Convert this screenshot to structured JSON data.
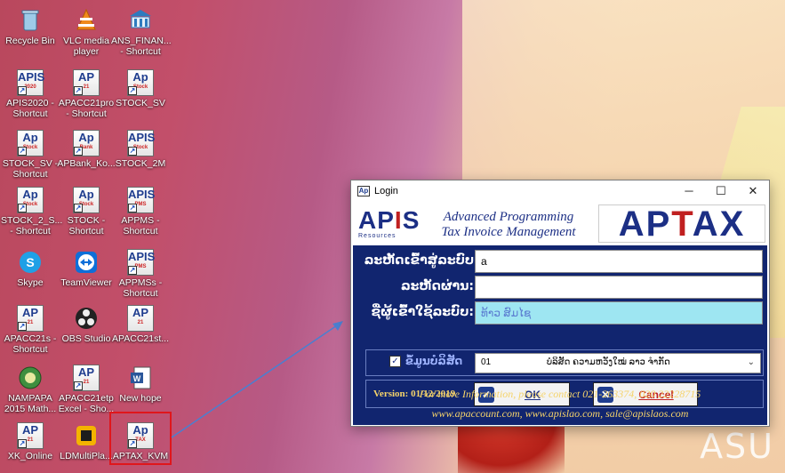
{
  "desktop": {
    "brand_text": "ASU",
    "icons": [
      {
        "label": "Recycle Bin",
        "icon": "recycle-bin-icon"
      },
      {
        "label": "VLC media player",
        "icon": "vlc-icon"
      },
      {
        "label": "ANS_FINAN... - Shortcut",
        "icon": "bank-icon"
      },
      {
        "label": "APIS2020 - Shortcut",
        "icon": "apis-icon"
      },
      {
        "label": "APACC21pro - Shortcut",
        "icon": "apacc-icon"
      },
      {
        "label": "STOCK_SV",
        "icon": "ap-icon"
      },
      {
        "label": "STOCK_SV - Shortcut",
        "icon": "ap-icon"
      },
      {
        "label": "APBank_Ko...",
        "icon": "ap-icon"
      },
      {
        "label": "STOCK_2M",
        "icon": "apis-icon"
      },
      {
        "label": "STOCK_2_S... - Shortcut",
        "icon": "ap-icon"
      },
      {
        "label": "STOCK - Shortcut",
        "icon": "ap-icon"
      },
      {
        "label": "APPMS - Shortcut",
        "icon": "apis-icon"
      },
      {
        "label": "Skype",
        "icon": "skype-icon"
      },
      {
        "label": "TeamViewer",
        "icon": "teamviewer-icon"
      },
      {
        "label": "APPMSs - Shortcut",
        "icon": "apis-icon"
      },
      {
        "label": "APACC21s - Shortcut",
        "icon": "apacc-icon"
      },
      {
        "label": "OBS Studio",
        "icon": "obs-icon"
      },
      {
        "label": "APACC21st...",
        "icon": "apacc-icon"
      },
      {
        "label": "NAMPAPA 2015 Math...",
        "icon": "nampapa-icon"
      },
      {
        "label": "APACC21etp Excel - Sho...",
        "icon": "apacc-icon"
      },
      {
        "label": "New hope",
        "icon": "word-doc-icon"
      },
      {
        "label": "XK_Online",
        "icon": "apacc-icon"
      },
      {
        "label": "LDMultiPla...",
        "icon": "ldplayer-icon"
      },
      {
        "label": "APTAX_KVM",
        "icon": "ap-icon"
      }
    ]
  },
  "window": {
    "title": "Login",
    "minimize": "─",
    "maximize": "☐",
    "close": "✕",
    "logo_text": "APIS",
    "logo_sub": "Resources",
    "header_line1": "Advanced Programming",
    "header_line2": "Tax Invoice Management",
    "brand": "APTAX",
    "fields": {
      "user_label": "ລະຫັດເຂົ້າສູ່ລະບົບ",
      "user_value": "a",
      "pass_label": "ລະຫັດຜ່ານ:",
      "pass_value": "",
      "name_label": "ຊື່ຜູ້ເຂົ້າໃຊ້ລະບົບ:",
      "name_value": "ທ້າວ ສົມໄຊ"
    },
    "database": {
      "label": "ຂໍ້ມູນບໍລິສັດ",
      "code": "01",
      "company": "ບໍລິສັດ ຄວາມຫວັງໃໝ່ ລາວ ຈໍາກັດ"
    },
    "version": "Version: 01/12/2019",
    "ok_label": "OK",
    "cancel_label": "Cancel",
    "info_line1": "For more Information, please contact 021-263374, 020 22228715",
    "info_line2": "www.apaccount.com, www.apislao.com, sale@apislaos.com"
  },
  "colors": {
    "dialog_bg": "#11256f",
    "accent_blue": "#1c2f85",
    "accent_red": "#c02020",
    "info_gold": "#f5d36a",
    "highlight_box": "#e0161b"
  }
}
